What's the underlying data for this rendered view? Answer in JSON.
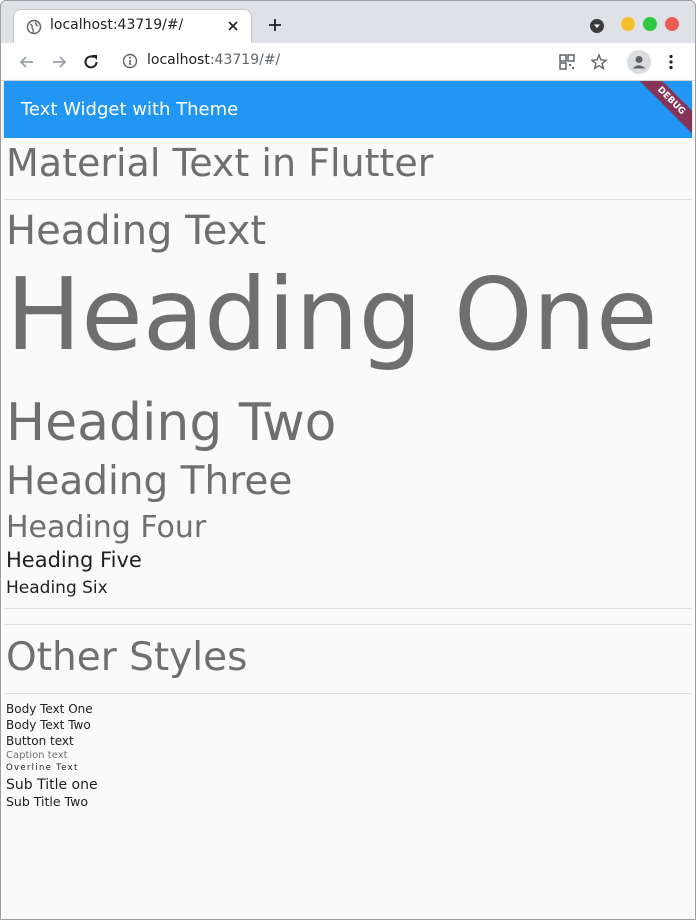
{
  "browser": {
    "tab_title": "localhost:43719/#/",
    "url_host": "localhost",
    "url_rest": ":43719/#/",
    "colors": {
      "minimize": "#f6c02c",
      "maximize": "#2dc840",
      "close": "#ee5b56"
    }
  },
  "app": {
    "title": "Text Widget with Theme",
    "debug_label": "DEBUG",
    "primary_color": "#2196f3"
  },
  "content": {
    "page_heading": "Material Text in Flutter",
    "section_heading": "Heading Text",
    "h1": "Heading One",
    "h2": "Heading Two",
    "h3": "Heading Three",
    "h4": "Heading Four",
    "h5": "Heading Five",
    "h6": "Heading Six",
    "other_heading": "Other Styles",
    "body1": "Body Text One",
    "body2": "Body Text Two",
    "button": "Button text",
    "caption": "Caption text",
    "overline": "Overline Text",
    "subtitle1": "Sub Title one",
    "subtitle2": "Sub Title Two"
  }
}
